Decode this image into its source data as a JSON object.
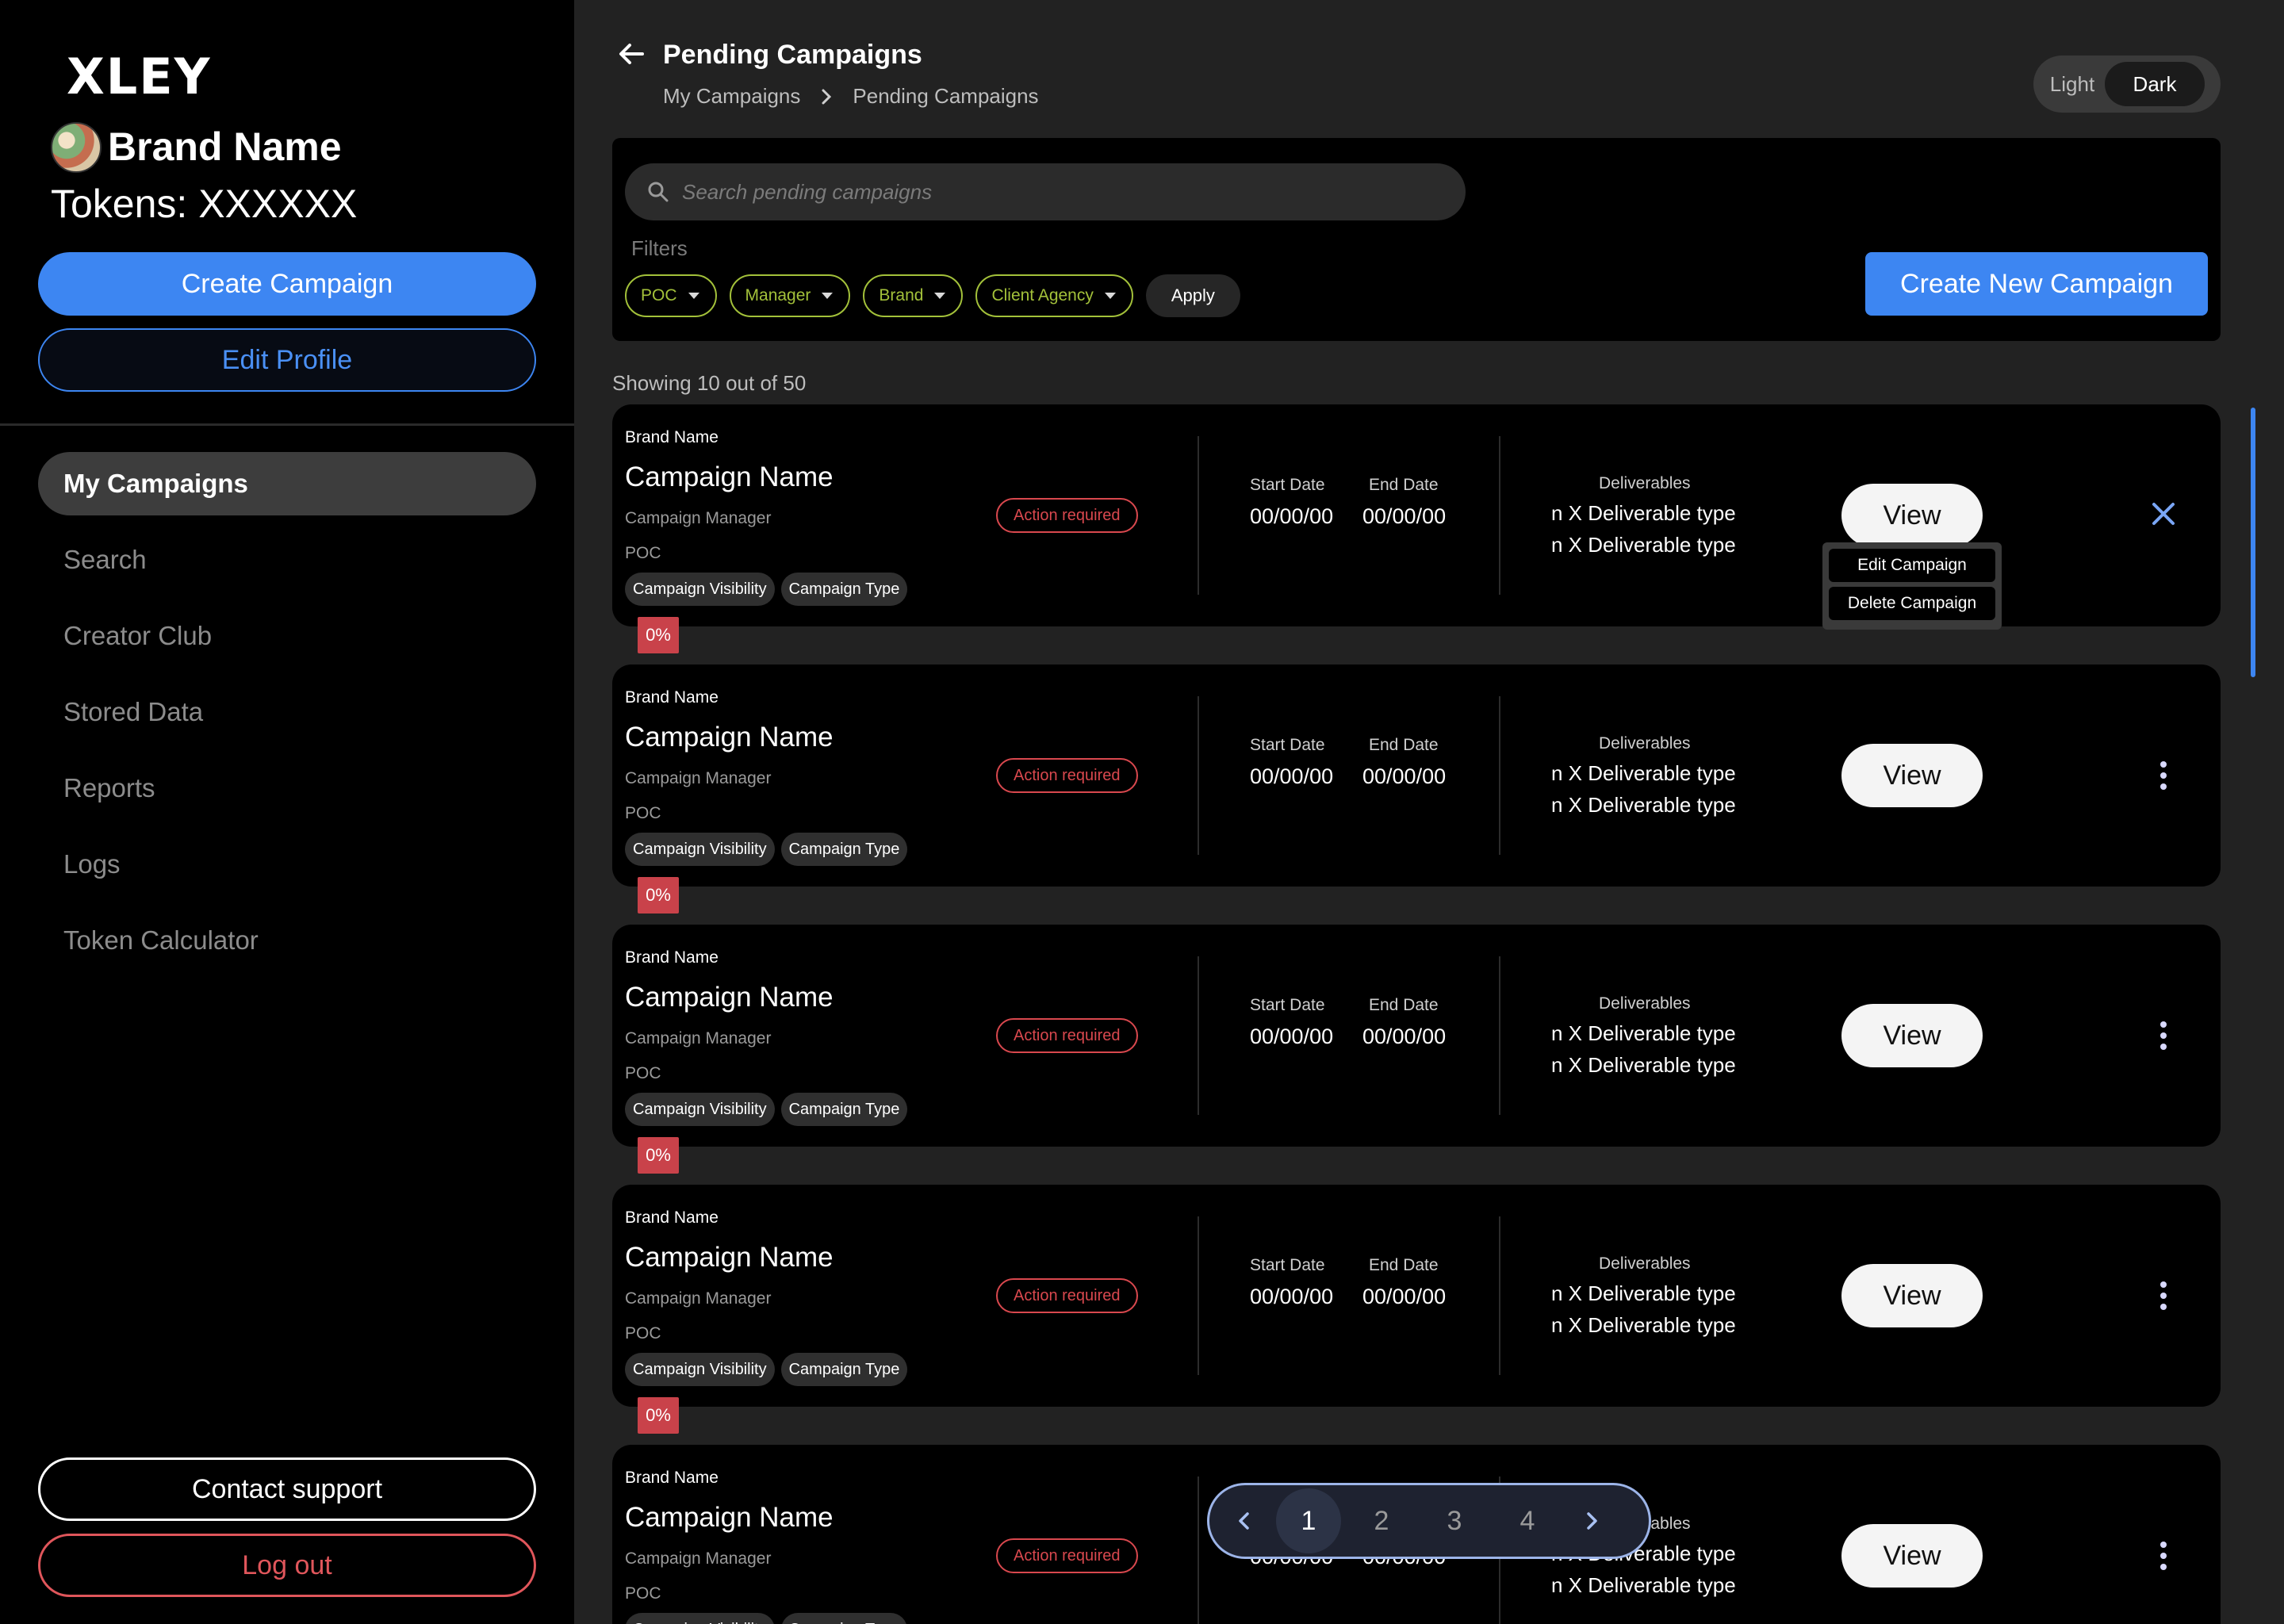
{
  "sidebar": {
    "logo": "XLEY",
    "brand_name": "Brand Name",
    "tokens": "Tokens: XXXXXX",
    "create_campaign": "Create Campaign",
    "edit_profile": "Edit Profile",
    "nav": [
      {
        "label": "My Campaigns",
        "active": true
      },
      {
        "label": "Search"
      },
      {
        "label": "Creator Club"
      },
      {
        "label": "Stored Data"
      },
      {
        "label": "Reports"
      },
      {
        "label": "Logs"
      },
      {
        "label": "Token Calculator"
      }
    ],
    "contact_support": "Contact support",
    "log_out": "Log out"
  },
  "header": {
    "title": "Pending Campaigns",
    "breadcrumb": [
      "My Campaigns",
      "Pending Campaigns"
    ],
    "theme": {
      "light": "Light",
      "dark": "Dark",
      "selected": "Dark"
    }
  },
  "filter_panel": {
    "search_placeholder": "Search pending campaigns",
    "filters_label": "Filters",
    "chips": [
      "POC",
      "Manager",
      "Brand",
      "Client Agency"
    ],
    "apply": "Apply",
    "create_new": "Create New Campaign"
  },
  "showing": "Showing 10 out of 50",
  "card": {
    "brand": "Brand Name",
    "name": "Campaign Name",
    "manager": "Campaign Manager",
    "poc": "POC",
    "tag_visibility": "Campaign Visibility",
    "tag_type": "Campaign Type",
    "action": "Action required",
    "start_label": "Start Date",
    "end_label": "End Date",
    "start": "00/00/00",
    "end": "00/00/00",
    "deliverables_label": "Deliverables",
    "deliverable": "n X Deliverable type",
    "view": "View",
    "progress": "0%"
  },
  "context_menu": {
    "edit": "Edit Campaign",
    "delete": "Delete Campaign"
  },
  "pagination": {
    "pages": [
      "1",
      "2",
      "3",
      "4"
    ],
    "current": "1"
  },
  "colors": {
    "accent": "#3d86f2",
    "danger": "#d9484e",
    "filter_chip": "#a3c13a"
  }
}
